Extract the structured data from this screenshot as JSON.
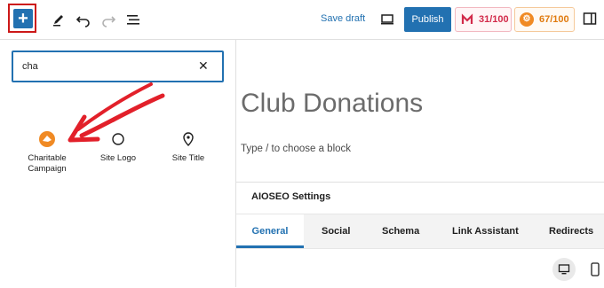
{
  "toolbar": {
    "add_icon": "plus-icon",
    "tools_icon": "pencil-icon",
    "undo_icon": "undo-icon",
    "redo_icon": "redo-icon",
    "list_view_icon": "list-view-icon",
    "save_draft_label": "Save draft",
    "preview_icon": "desktop-preview-icon",
    "publish_label": "Publish",
    "readability_score": "31/100",
    "seo_score": "67/100",
    "sidebar_icon": "sidebar-toggle-icon"
  },
  "inserter": {
    "search_value": "cha",
    "clear_icon": "close-icon",
    "blocks": [
      {
        "label_line1": "Charitable",
        "label_line2": "Campaign",
        "icon": "charitable-campaign-icon"
      },
      {
        "label_line1": "Site Logo",
        "label_line2": "",
        "icon": "site-logo-icon"
      },
      {
        "label_line1": "Site Title",
        "label_line2": "",
        "icon": "map-pin-icon"
      }
    ]
  },
  "editor": {
    "post_title": "Club Donations",
    "block_hint": "Type / to choose a block"
  },
  "aioseo": {
    "title": "AIOSEO Settings",
    "tabs": [
      "General",
      "Social",
      "Schema",
      "Link Assistant",
      "Redirects"
    ],
    "active_tab": "General"
  },
  "colors": {
    "accent": "#2271b1",
    "highlight_box": "#cc1818",
    "annotation_arrow": "#e2202a",
    "readability_red": "#d22a4a",
    "seo_orange": "#f08a24"
  }
}
